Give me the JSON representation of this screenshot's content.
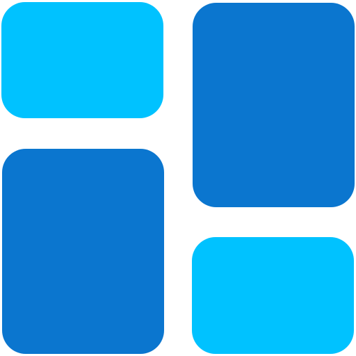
{
  "icon": {
    "name": "dashboard-layout-icon",
    "colors": {
      "light_blue": "#00C2FF",
      "dark_blue": "#0B76CF",
      "background": "#FFFFFF"
    },
    "tiles": [
      {
        "id": "top-left",
        "color": "light_blue"
      },
      {
        "id": "top-right",
        "color": "dark_blue"
      },
      {
        "id": "bottom-left",
        "color": "dark_blue"
      },
      {
        "id": "bottom-right",
        "color": "light_blue"
      }
    ]
  }
}
